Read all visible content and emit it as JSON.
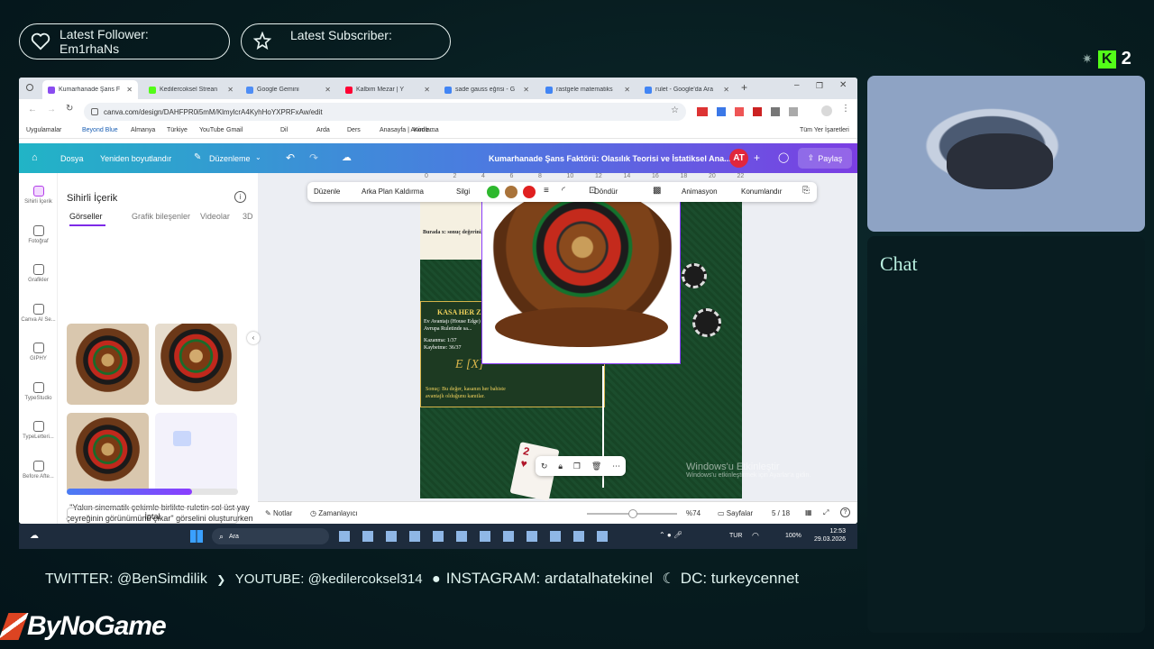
{
  "overlay": {
    "follower_label": "Latest Follower:",
    "follower_name": "Em1rhaNs",
    "subscriber_label": "Latest Subscriber:",
    "kick_badge": "2",
    "chat_title": "Chat",
    "brand": "ByNoGame",
    "social": {
      "twitter": "TWITTER: @BenSimdilik",
      "youtube": "YOUTUBE: @kedilercoksel314",
      "instagram": "INSTAGRAM: ardatalhatekinel",
      "discord": "DC: turkeycennet"
    }
  },
  "browser": {
    "tabs": [
      {
        "label": "Kumarhanade Şans F",
        "color": "#8a4cf0",
        "active": true
      },
      {
        "label": "Kedilercoksel Strean",
        "color": "#53fc18",
        "active": false
      },
      {
        "label": "Google Gemini",
        "color": "#4e8df5",
        "active": false
      },
      {
        "label": "Kalbim Mezar | Y",
        "color": "#ff0033",
        "active": false
      },
      {
        "label": "sade gauss eğrisi - G",
        "color": "#4285f4",
        "active": false
      },
      {
        "label": "rastgele matematiks",
        "color": "#4285f4",
        "active": false
      },
      {
        "label": "rulet - Google'da Ara",
        "color": "#4285f4",
        "active": false
      }
    ],
    "url": "canva.com/design/DAHFPR0i5mM/KlmylcrA4KyhHoYXPRFxAw/edit",
    "bookmarks": [
      "Uygulamalar",
      "Beyond Blue",
      "Almanya",
      "Türkiye",
      "YouTube",
      "Gmail",
      "Dil",
      "Arda",
      "Ders",
      "Anasayfa | Anime ...",
      "Kodlama",
      "Tüm Yer İşaretleri"
    ]
  },
  "canva": {
    "menu_file": "Dosya",
    "menu_resize": "Yeniden boyutlandır",
    "menu_edit": "Düzenleme",
    "doc_title": "Kumarhanade Şans Faktörü: Olasılık Teorisi ve İstatiksel Ana...",
    "avatar": "AT",
    "share": "Paylaş",
    "rail": [
      "Sihirli İçerik",
      "Fotoğraf",
      "Grafikler",
      "Canva AI Se...",
      "GIPHY",
      "TypeStudio",
      "TypeLetteri...",
      "Before Afte..."
    ],
    "panel": {
      "title": "Sihirli İçerik",
      "tabs": [
        "Görseller",
        "Grafik bileşenler",
        "Videolar",
        "3D"
      ],
      "status": "\"Yakın sinematik çekimle birlikte ruletin sol üst yay çeyreğinin görünümünü çıkar\" görselini oluştururken lütfen bekleyin.",
      "progress": 0.73,
      "cancel": "İptal"
    },
    "toolbar": [
      "Düzenle",
      "Arka Plan Kaldırma",
      "Silgi",
      "Döndür",
      "Animasyon",
      "Konumlandır"
    ],
    "toolbar_colors": [
      "#2eb82e",
      "#a9733a",
      "#e02020"
    ],
    "ruler_ticks": [
      "0",
      "2",
      "4",
      "6",
      "8",
      "10",
      "12",
      "14",
      "16",
      "18",
      "20",
      "22"
    ],
    "slide": {
      "line1": "Burada x: sonuç değerini, P(x) ise olasılığı temsil eder",
      "heading": "KASA HER ZAMAN KAZANIR MI?",
      "l1": "Ev Avantajı (House Edge)",
      "l2": "Avrupa Ruletinde sa...",
      "l3": "Kazanma: 1/37",
      "l4": "Kaybetme: 36/37",
      "formula": "E [X]",
      "result": "Sonuç: Bu değer, kasanın her bahiste",
      "result2": "avantajlı olduğunu kanıtlar."
    },
    "bottom": {
      "notes": "Notlar",
      "timer": "Zamanlayıcı",
      "zoom": "%74",
      "pages": "Sayfalar",
      "page_count": "5 / 18"
    },
    "activation": "Windows'u Etkinleştir",
    "activation_sub": "Windows'u etkinleştirmek için Ayarlar'a gidin."
  },
  "taskbar": {
    "search": "Ara",
    "lang": "TUR",
    "battery": "100%",
    "time": "12:53",
    "date": "29.03.2026"
  }
}
